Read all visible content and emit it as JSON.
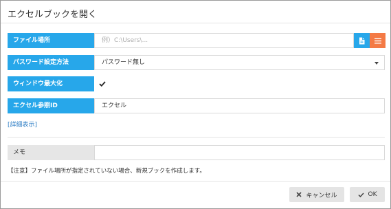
{
  "dialog": {
    "title": "エクセルブックを開く"
  },
  "form": {
    "file_location": {
      "label": "ファイル場所",
      "placeholder": "例）C:\\Users\\...",
      "value": ""
    },
    "password": {
      "label": "パスワード設定方法",
      "selected": "パスワード無し"
    },
    "maximize": {
      "label": "ウィンドウ最大化",
      "checked": true
    },
    "excel_ref_id": {
      "label": "エクセル参照ID",
      "value": "エクセル"
    },
    "details_link": "[詳細表示]",
    "memo": {
      "label": "メモ",
      "value": ""
    },
    "note": "【注意】ファイル場所が指定されていない場合、新規ブックを作成します。"
  },
  "footer": {
    "cancel_label": "キャンセル",
    "ok_label": "OK"
  },
  "colors": {
    "label_bg": "#27a7ea",
    "file_button": "#27a7ea",
    "list_button": "#f47a45",
    "link": "#2b7cc4"
  }
}
